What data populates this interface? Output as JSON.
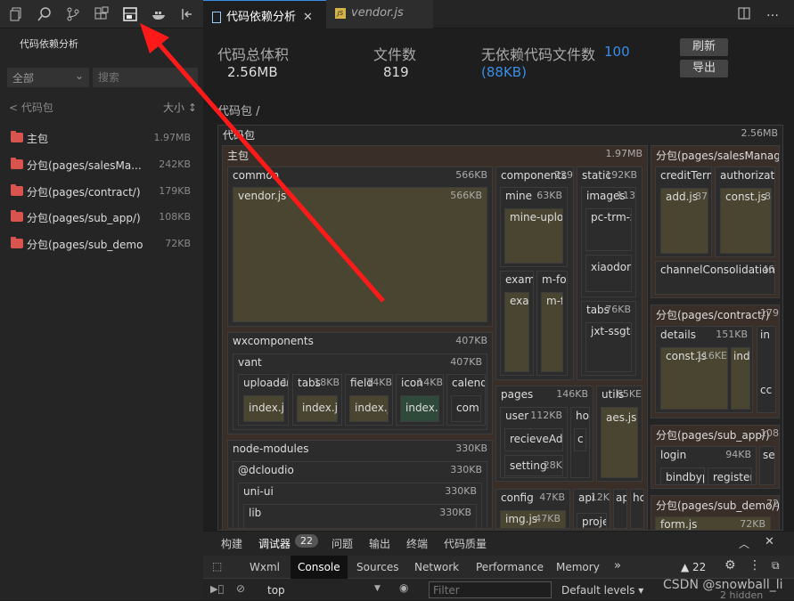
{
  "toolbar": {
    "icons": [
      "files-icon",
      "search-icon",
      "source-control-icon",
      "extensions-icon",
      "code-analysis-icon",
      "docker-icon",
      "collapse-panel-icon"
    ]
  },
  "left_panel": {
    "title": "代码依赖分析",
    "filter_value": "全部",
    "search_placeholder": "搜索",
    "breadcrumb": "< 代码包",
    "sort_label": "大小 ↕",
    "packages": [
      {
        "name": "主包",
        "size": "1.97MB"
      },
      {
        "name": "分包(pages/salesMa...",
        "size": "242KB"
      },
      {
        "name": "分包(pages/contract/)",
        "size": "179KB"
      },
      {
        "name": "分包(pages/sub_app/)",
        "size": "108KB"
      },
      {
        "name": "分包(pages/sub_demo/)",
        "size": "72KB"
      }
    ]
  },
  "tabs": {
    "active": "代码依赖分析",
    "second": "vendor.js"
  },
  "stats": {
    "total_label": "代码总体积",
    "total_value": "2.56MB",
    "files_label": "文件数",
    "files_value": "819",
    "nodep_label": "无依赖代码文件数",
    "nodep_count": "100",
    "nodep_size": "(88KB)",
    "refresh": "刷新",
    "export": "导出"
  },
  "package_breadcrumb": "代码包 /",
  "treemap": {
    "root": {
      "label": "代码包",
      "size": "2.56MB"
    },
    "main": {
      "label": "主包",
      "size": "1.97MB"
    },
    "common": {
      "label": "common",
      "size": "566KB"
    },
    "vendor": {
      "label": "vendor.js",
      "size": "566KB"
    },
    "components": {
      "label": "components",
      "size": "229"
    },
    "mine": {
      "label": "mine",
      "size": "63KB"
    },
    "mine_upload": {
      "label": "mine-uploa"
    },
    "exami": {
      "label": "exami"
    },
    "exan": {
      "label": "exan"
    },
    "m_for": {
      "label": "m-for"
    },
    "m_f": {
      "label": "m-f"
    },
    "static": {
      "label": "static",
      "size": "192KB"
    },
    "images": {
      "label": "images",
      "size": "113"
    },
    "pc_trm": {
      "label": "pc-trm-z"
    },
    "xiaodong": {
      "label": "xiaodong"
    },
    "tabs": {
      "label": "tabs",
      "size": "76KB"
    },
    "jxt": {
      "label": "jxt-ssgt-"
    },
    "wxcomponents": {
      "label": "wxcomponents",
      "size": "407KB"
    },
    "vant": {
      "label": "vant",
      "size": "407KB"
    },
    "vant_items": [
      {
        "label": "uploader",
        "size": "1",
        "file": "index.js"
      },
      {
        "label": "tabs",
        "size": "18KB",
        "file": "index.js"
      },
      {
        "label": "field",
        "size": "14KB",
        "file": "index.js"
      },
      {
        "label": "icon",
        "size": "14KB",
        "file": "index.w"
      },
      {
        "label": "calend",
        "size": "",
        "file": "com"
      }
    ],
    "node_modules": {
      "label": "node-modules",
      "size": "330KB"
    },
    "dcloudio": {
      "label": "@dcloudio",
      "size": "330KB"
    },
    "uni_ui": {
      "label": "uni-ui",
      "size": "330KB"
    },
    "lib": {
      "label": "lib",
      "size": "330KB"
    },
    "pages": {
      "label": "pages",
      "size": "146KB"
    },
    "user": {
      "label": "user",
      "size": "112KB"
    },
    "recieve": {
      "label": "recieveAdc"
    },
    "setting": {
      "label": "setting",
      "size": "28K"
    },
    "hor": {
      "label": "hor"
    },
    "c": {
      "label": "c"
    },
    "utils": {
      "label": "utils",
      "size": "65KE"
    },
    "aes": {
      "label": "aes.js"
    },
    "config": {
      "label": "config",
      "size": "47KB"
    },
    "img": {
      "label": "img.js",
      "size": "47KB"
    },
    "api": {
      "label": "api",
      "size": "12K"
    },
    "projec": {
      "label": "projec"
    },
    "ap": {
      "label": "ap"
    },
    "ho": {
      "label": "ho"
    },
    "sales": {
      "label": "分包(pages/salesManager"
    },
    "creditterm": {
      "label": "creditTerm"
    },
    "add": {
      "label": "add.js",
      "size": "87"
    },
    "authoriz": {
      "label": "authorizatio"
    },
    "const8": {
      "label": "const.js",
      "size": "8"
    },
    "channel": {
      "label": "channelConsolidation",
      "size": "46"
    },
    "contract": {
      "label": "分包(pages/contract/)",
      "size": "179"
    },
    "details": {
      "label": "details",
      "size": "151KB"
    },
    "const116": {
      "label": "const.js",
      "size": "116KE"
    },
    "ind": {
      "label": "ind"
    },
    "in": {
      "label": "in"
    },
    "cc": {
      "label": "cc"
    },
    "subapp": {
      "label": "分包(pages/sub_app/)",
      "size": "108"
    },
    "login": {
      "label": "login",
      "size": "94KB"
    },
    "bindbyp": {
      "label": "bindbyp"
    },
    "register": {
      "label": "register"
    },
    "se": {
      "label": "se"
    },
    "subdemo": {
      "label": "分包(pages/sub_demo/)",
      "size": "72"
    },
    "formjs": {
      "label": "form.js",
      "size": "72KB"
    }
  },
  "debug": {
    "tabs": [
      "构建",
      "调试器",
      "问题",
      "输出",
      "终端",
      "代码质量"
    ],
    "debugger_count": "22",
    "devtools_tabs": [
      "Wxml",
      "Console",
      "Sources",
      "Network",
      "Performance",
      "Memory"
    ],
    "more": "»",
    "warnings": "▲ 22",
    "context": "top",
    "filter_placeholder": "Filter",
    "levels": "Default levels ▾",
    "hidden": "2 hidden"
  },
  "watermark": "CSDN @snowball_li"
}
